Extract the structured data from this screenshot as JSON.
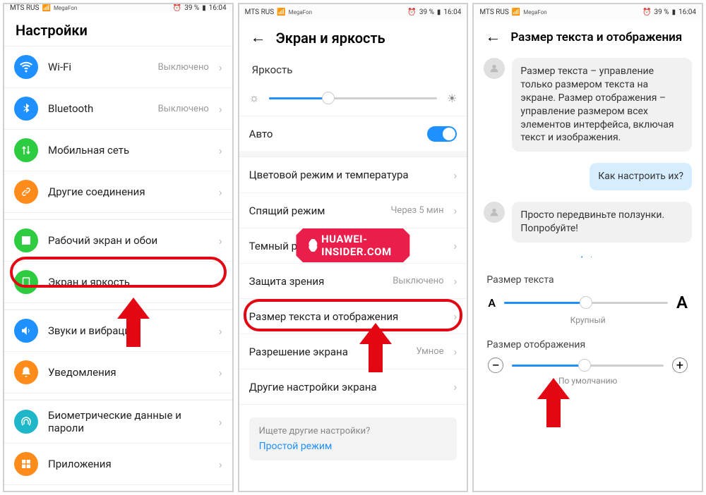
{
  "status": {
    "carrier": "MTS RUS",
    "sub": "MegaFon",
    "battery": "39 %",
    "time": "16:04",
    "alarm": "⏰"
  },
  "screen1": {
    "title": "Настройки",
    "rows": [
      {
        "icon": "wifi",
        "color": "#1e90ff",
        "label": "Wi-Fi",
        "value": "Выключено"
      },
      {
        "icon": "bluetooth",
        "color": "#1e90ff",
        "label": "Bluetooth",
        "value": "Выключено"
      },
      {
        "icon": "mobile",
        "color": "#2ecc40",
        "label": "Мобильная сеть",
        "value": ""
      },
      {
        "icon": "link",
        "color": "#ff8c1a",
        "label": "Другие соединения",
        "value": ""
      }
    ],
    "rows2": [
      {
        "icon": "home",
        "color": "#2ecc40",
        "label": "Рабочий экран и обои"
      },
      {
        "icon": "display",
        "color": "#2ecc40",
        "label": "Экран и яркость"
      }
    ],
    "rows3": [
      {
        "icon": "sound",
        "color": "#1e90ff",
        "label": "Звуки и вибрация"
      },
      {
        "icon": "bell",
        "color": "#ff8c1a",
        "label": "Уведомления"
      }
    ],
    "rows4": [
      {
        "icon": "finger",
        "color": "#1eb6c9",
        "label": "Биометрические данные и пароли"
      },
      {
        "icon": "apps",
        "color": "#ff8c1a",
        "label": "Приложения"
      }
    ]
  },
  "screen2": {
    "title": "Экран и яркость",
    "brightness_label": "Яркость",
    "auto_label": "Авто",
    "rows": [
      {
        "label": "Цветовой режим и температура",
        "value": ""
      },
      {
        "label": "Спящий режим",
        "value": "Через 5 мин"
      },
      {
        "label": "Темный режим",
        "value": ""
      },
      {
        "label": "Защита зрения",
        "value": "Выключено"
      },
      {
        "label": "Размер текста и отображения",
        "value": ""
      },
      {
        "label": "Разрешение экрана",
        "value": "Умное"
      },
      {
        "label": "Другие настройки экрана",
        "value": ""
      }
    ],
    "hint_q": "Ищете другие настройки?",
    "hint_a": "Простой режим",
    "watermark": "HUAWEI-INSIDER.COM"
  },
  "screen3": {
    "title": "Размер текста и отображения",
    "msg1": "Размер текста – управление только размером текста на экране. Размер отображения – управление размером всех элементов интерфейса, включая текст и изображения.",
    "msg2": "Как настроить их?",
    "msg3": "Просто передвиньте ползунки. Попробуйте!",
    "text_size_label": "Размер текста",
    "text_size_value": "Крупный",
    "display_size_label": "Размер отображения",
    "display_size_value": "По умолчанию"
  }
}
